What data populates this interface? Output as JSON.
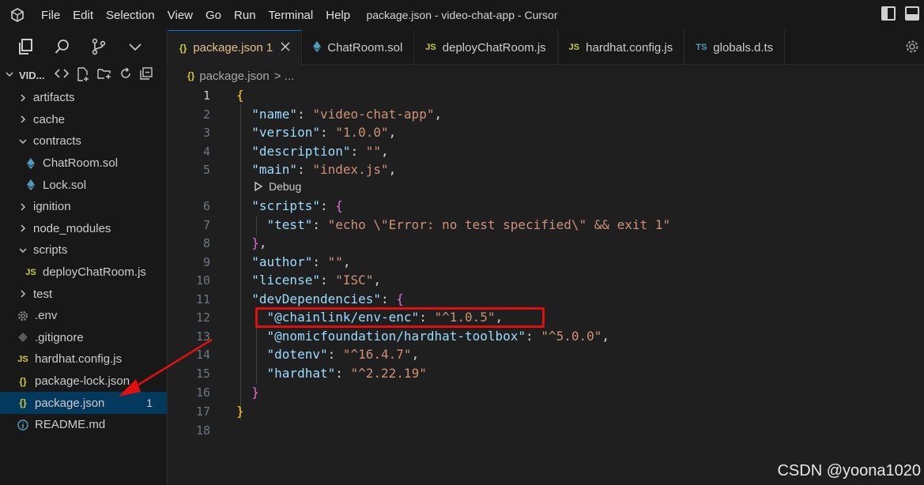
{
  "window": {
    "title": "package.json - video-chat-app - Cursor",
    "menu": [
      "File",
      "Edit",
      "Selection",
      "View",
      "Go",
      "Run",
      "Terminal",
      "Help"
    ]
  },
  "explorer": {
    "folder_name": "VID...",
    "items": [
      {
        "label": "artifacts",
        "type": "folder",
        "expanded": false,
        "depth": 0
      },
      {
        "label": "cache",
        "type": "folder",
        "expanded": false,
        "depth": 0
      },
      {
        "label": "contracts",
        "type": "folder",
        "expanded": true,
        "depth": 0
      },
      {
        "label": "ChatRoom.sol",
        "type": "sol",
        "depth": 1
      },
      {
        "label": "Lock.sol",
        "type": "sol",
        "depth": 1
      },
      {
        "label": "ignition",
        "type": "folder",
        "expanded": false,
        "depth": 0
      },
      {
        "label": "node_modules",
        "type": "folder",
        "expanded": false,
        "depth": 0
      },
      {
        "label": "scripts",
        "type": "folder",
        "expanded": true,
        "depth": 0
      },
      {
        "label": "deployChatRoom.js",
        "type": "js",
        "depth": 1
      },
      {
        "label": "test",
        "type": "folder",
        "expanded": false,
        "depth": 0
      },
      {
        "label": ".env",
        "type": "env",
        "depth": 0
      },
      {
        "label": ".gitignore",
        "type": "git",
        "depth": 0
      },
      {
        "label": "hardhat.config.js",
        "type": "js",
        "depth": 0
      },
      {
        "label": "package-lock.json",
        "type": "json",
        "depth": 0
      },
      {
        "label": "package.json",
        "type": "json",
        "depth": 0,
        "active": true,
        "badge": "1"
      },
      {
        "label": "README.md",
        "type": "info",
        "depth": 0
      }
    ]
  },
  "tabs": [
    {
      "label": "package.json 1",
      "icon": "{}",
      "active": true
    },
    {
      "label": "ChatRoom.sol",
      "icon": "sol"
    },
    {
      "label": "deployChatRoom.js",
      "icon": "JS"
    },
    {
      "label": "hardhat.config.js",
      "icon": "JS"
    },
    {
      "label": "globals.d.ts",
      "icon": "TS"
    }
  ],
  "breadcrumb": {
    "file": "package.json",
    "sep": "> ..."
  },
  "codelens": "Debug",
  "code_lines": [
    {
      "n": "1",
      "tokens": [
        [
          "b1",
          "{"
        ]
      ]
    },
    {
      "n": "2",
      "tokens": [
        [
          "p",
          "  "
        ],
        [
          "k",
          "\"name\""
        ],
        [
          "p",
          ": "
        ],
        [
          "s",
          "\"video-chat-app\""
        ],
        [
          "p",
          ","
        ]
      ]
    },
    {
      "n": "3",
      "tokens": [
        [
          "p",
          "  "
        ],
        [
          "k",
          "\"version\""
        ],
        [
          "p",
          ": "
        ],
        [
          "s",
          "\"1.0.0\""
        ],
        [
          "p",
          ","
        ]
      ]
    },
    {
      "n": "4",
      "tokens": [
        [
          "p",
          "  "
        ],
        [
          "k",
          "\"description\""
        ],
        [
          "p",
          ": "
        ],
        [
          "s",
          "\"\""
        ],
        [
          "p",
          ","
        ]
      ]
    },
    {
      "n": "5",
      "tokens": [
        [
          "p",
          "  "
        ],
        [
          "k",
          "\"main\""
        ],
        [
          "p",
          ": "
        ],
        [
          "s",
          "\"index.js\""
        ],
        [
          "p",
          ","
        ]
      ]
    },
    {
      "n": "6",
      "tokens": [
        [
          "p",
          "  "
        ],
        [
          "k",
          "\"scripts\""
        ],
        [
          "p",
          ": "
        ],
        [
          "b2",
          "{"
        ]
      ]
    },
    {
      "n": "7",
      "tokens": [
        [
          "p",
          "    "
        ],
        [
          "k",
          "\"test\""
        ],
        [
          "p",
          ": "
        ],
        [
          "s",
          "\"echo \\\"Error: no test specified\\\" && exit 1\""
        ]
      ]
    },
    {
      "n": "8",
      "tokens": [
        [
          "p",
          "  "
        ],
        [
          "b2",
          "}"
        ],
        [
          "p",
          ","
        ]
      ]
    },
    {
      "n": "9",
      "tokens": [
        [
          "p",
          "  "
        ],
        [
          "k",
          "\"author\""
        ],
        [
          "p",
          ": "
        ],
        [
          "s",
          "\"\""
        ],
        [
          "p",
          ","
        ]
      ]
    },
    {
      "n": "10",
      "tokens": [
        [
          "p",
          "  "
        ],
        [
          "k",
          "\"license\""
        ],
        [
          "p",
          ": "
        ],
        [
          "s",
          "\"ISC\""
        ],
        [
          "p",
          ","
        ]
      ]
    },
    {
      "n": "11",
      "tokens": [
        [
          "p",
          "  "
        ],
        [
          "k",
          "\"devDependencies\""
        ],
        [
          "p",
          ": "
        ],
        [
          "b2",
          "{"
        ]
      ]
    },
    {
      "n": "12",
      "tokens": [
        [
          "p",
          "    "
        ],
        [
          "k",
          "\"@chainlink/env-enc\""
        ],
        [
          "p",
          ": "
        ],
        [
          "s",
          "\"^1.0.5\""
        ],
        [
          "p",
          ","
        ]
      ]
    },
    {
      "n": "13",
      "tokens": [
        [
          "p",
          "    "
        ],
        [
          "k",
          "\"@nomicfoundation/hardhat-toolbox\""
        ],
        [
          "p",
          ": "
        ],
        [
          "s",
          "\"^5.0.0\""
        ],
        [
          "p",
          ","
        ]
      ]
    },
    {
      "n": "14",
      "tokens": [
        [
          "p",
          "    "
        ],
        [
          "k",
          "\"dotenv\""
        ],
        [
          "p",
          ": "
        ],
        [
          "s",
          "\"^16.4.7\""
        ],
        [
          "p",
          ","
        ]
      ]
    },
    {
      "n": "15",
      "tokens": [
        [
          "p",
          "    "
        ],
        [
          "k",
          "\"hardhat\""
        ],
        [
          "p",
          ": "
        ],
        [
          "s",
          "\"^2.22.19\""
        ]
      ]
    },
    {
      "n": "16",
      "tokens": [
        [
          "p",
          "  "
        ],
        [
          "b2",
          "}"
        ]
      ]
    },
    {
      "n": "17",
      "tokens": [
        [
          "b1",
          "}"
        ]
      ]
    },
    {
      "n": "18",
      "tokens": []
    }
  ],
  "watermark": "CSDN @yoona1020"
}
